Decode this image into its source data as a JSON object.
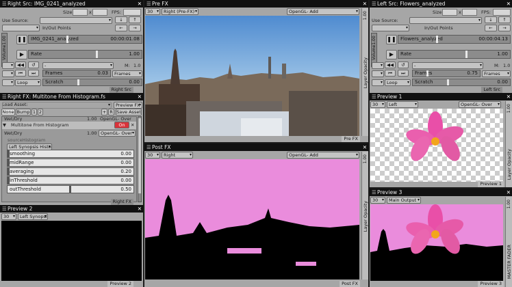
{
  "right_src": {
    "title": "Right Src: IMG_0241_analyzed",
    "size_label": "Size:",
    "fps_label": "FPS:",
    "use_source_label": "Use Source:",
    "inout_label": "In/Out Points",
    "volume_label": "Volume1.00",
    "clip_name": "IMG_0241_analyzed",
    "timecode": "00:00:01.08",
    "rate_label": "Rate",
    "rate_value": "1.00",
    "m_label": "M:",
    "m_value": "1.0",
    "frames_label": "Frames",
    "frames_value": "0.03",
    "frames_dd": "Frames",
    "loop_label": "Loop",
    "scratch_label": "Scratch",
    "scratch_value": "0.00",
    "footer": "Right Src"
  },
  "pre_fx": {
    "title": "Pre FX",
    "res": "30",
    "source": "Right (Pre-FX)",
    "blend": "OpenGL- Add",
    "side_value": "1.00",
    "side_label": "Layer Opacity",
    "footer": "Pre FX"
  },
  "left_src": {
    "title": "Left Src: Flowers_analyzed",
    "size_label": "Size:",
    "fps_label": "FPS:",
    "use_source_label": "Use Source:",
    "inout_label": "In/Out Points",
    "volume_label": "Volume1.00",
    "clip_name": "Flowers_analyzed",
    "timecode": "00:00:04.13",
    "rate_label": "Rate",
    "rate_value": "1.00",
    "m_label": "M:",
    "m_value": "1.0",
    "frames_label": "Frames",
    "frames_value": "0.75",
    "frames_dd": "Frames",
    "loop_label": "Loop",
    "scratch_label": "Scratch",
    "scratch_value": "0.00",
    "footer": "Left Src"
  },
  "right_fx": {
    "title": "Right FX: Multitone From Histogram.fs",
    "load_asset": "Load Asset:",
    "preview_fx": "Preview FX",
    "tabs": [
      "None",
      "Bump",
      "1",
      "2"
    ],
    "save_asset": "Save Asset",
    "wetdry_top": "Wet/Dry",
    "wetdry_top_value": "1.00",
    "blend_top": "OpenGL- Over",
    "effect_name": "Multitone From Histogram",
    "on_label": "On",
    "wetdry": "Wet/Dry",
    "wetdry_value": "1.00",
    "blend": "OpenGL- Over",
    "source_hist_label": "sourceHistogram",
    "source_hist_value": "Left Synopsis Histo",
    "params": [
      {
        "name": "smoothing",
        "value": "0.00"
      },
      {
        "name": "midRange",
        "value": "0.00"
      },
      {
        "name": "averaging",
        "value": "0.20"
      },
      {
        "name": "inThreshold",
        "value": "0.00"
      },
      {
        "name": "outThreshold",
        "value": "0.50"
      }
    ],
    "footer": "Right FX"
  },
  "preview1": {
    "title": "Preview 1",
    "res": "30",
    "source": "Left",
    "blend": "OpenGL- Over",
    "side_value": "1.00",
    "side_label": "Layer Opacity",
    "footer": "Preview 1"
  },
  "post_fx": {
    "title": "Post FX",
    "res": "30",
    "source": "Right",
    "blend": "OpenGL- Add",
    "side_value": "1.00",
    "side_label": "Layer Opacity",
    "footer": "Post FX"
  },
  "preview2": {
    "title": "Preview 2",
    "res": "30",
    "source": "Left Synopsis",
    "footer": "Preview 2"
  },
  "preview3": {
    "title": "Preview 3",
    "res": "30",
    "source": "Main Output",
    "side_value": "1.00",
    "side_label": "MASTER FADER",
    "footer": "Preview 3"
  },
  "icons": {
    "pause": "pause-icon",
    "rewind": "rewind-icon",
    "restart": "restart-icon",
    "loop": "loop-icon",
    "close": "close-icon"
  }
}
